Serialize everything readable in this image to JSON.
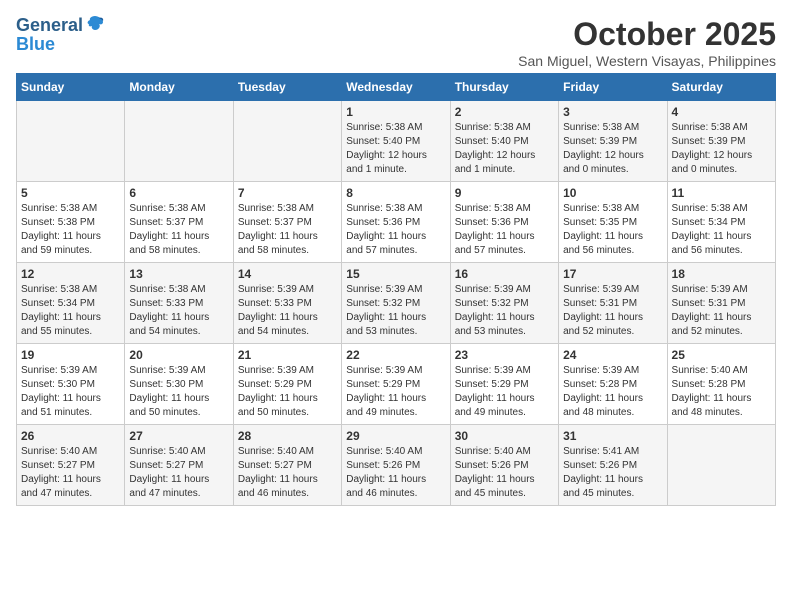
{
  "logo": {
    "line1": "General",
    "line2": "Blue"
  },
  "title": "October 2025",
  "location": "San Miguel, Western Visayas, Philippines",
  "weekdays": [
    "Sunday",
    "Monday",
    "Tuesday",
    "Wednesday",
    "Thursday",
    "Friday",
    "Saturday"
  ],
  "weeks": [
    [
      {
        "day": "",
        "info": ""
      },
      {
        "day": "",
        "info": ""
      },
      {
        "day": "",
        "info": ""
      },
      {
        "day": "1",
        "info": "Sunrise: 5:38 AM\nSunset: 5:40 PM\nDaylight: 12 hours\nand 1 minute."
      },
      {
        "day": "2",
        "info": "Sunrise: 5:38 AM\nSunset: 5:40 PM\nDaylight: 12 hours\nand 1 minute."
      },
      {
        "day": "3",
        "info": "Sunrise: 5:38 AM\nSunset: 5:39 PM\nDaylight: 12 hours\nand 0 minutes."
      },
      {
        "day": "4",
        "info": "Sunrise: 5:38 AM\nSunset: 5:39 PM\nDaylight: 12 hours\nand 0 minutes."
      }
    ],
    [
      {
        "day": "5",
        "info": "Sunrise: 5:38 AM\nSunset: 5:38 PM\nDaylight: 11 hours\nand 59 minutes."
      },
      {
        "day": "6",
        "info": "Sunrise: 5:38 AM\nSunset: 5:37 PM\nDaylight: 11 hours\nand 58 minutes."
      },
      {
        "day": "7",
        "info": "Sunrise: 5:38 AM\nSunset: 5:37 PM\nDaylight: 11 hours\nand 58 minutes."
      },
      {
        "day": "8",
        "info": "Sunrise: 5:38 AM\nSunset: 5:36 PM\nDaylight: 11 hours\nand 57 minutes."
      },
      {
        "day": "9",
        "info": "Sunrise: 5:38 AM\nSunset: 5:36 PM\nDaylight: 11 hours\nand 57 minutes."
      },
      {
        "day": "10",
        "info": "Sunrise: 5:38 AM\nSunset: 5:35 PM\nDaylight: 11 hours\nand 56 minutes."
      },
      {
        "day": "11",
        "info": "Sunrise: 5:38 AM\nSunset: 5:34 PM\nDaylight: 11 hours\nand 56 minutes."
      }
    ],
    [
      {
        "day": "12",
        "info": "Sunrise: 5:38 AM\nSunset: 5:34 PM\nDaylight: 11 hours\nand 55 minutes."
      },
      {
        "day": "13",
        "info": "Sunrise: 5:38 AM\nSunset: 5:33 PM\nDaylight: 11 hours\nand 54 minutes."
      },
      {
        "day": "14",
        "info": "Sunrise: 5:39 AM\nSunset: 5:33 PM\nDaylight: 11 hours\nand 54 minutes."
      },
      {
        "day": "15",
        "info": "Sunrise: 5:39 AM\nSunset: 5:32 PM\nDaylight: 11 hours\nand 53 minutes."
      },
      {
        "day": "16",
        "info": "Sunrise: 5:39 AM\nSunset: 5:32 PM\nDaylight: 11 hours\nand 53 minutes."
      },
      {
        "day": "17",
        "info": "Sunrise: 5:39 AM\nSunset: 5:31 PM\nDaylight: 11 hours\nand 52 minutes."
      },
      {
        "day": "18",
        "info": "Sunrise: 5:39 AM\nSunset: 5:31 PM\nDaylight: 11 hours\nand 52 minutes."
      }
    ],
    [
      {
        "day": "19",
        "info": "Sunrise: 5:39 AM\nSunset: 5:30 PM\nDaylight: 11 hours\nand 51 minutes."
      },
      {
        "day": "20",
        "info": "Sunrise: 5:39 AM\nSunset: 5:30 PM\nDaylight: 11 hours\nand 50 minutes."
      },
      {
        "day": "21",
        "info": "Sunrise: 5:39 AM\nSunset: 5:29 PM\nDaylight: 11 hours\nand 50 minutes."
      },
      {
        "day": "22",
        "info": "Sunrise: 5:39 AM\nSunset: 5:29 PM\nDaylight: 11 hours\nand 49 minutes."
      },
      {
        "day": "23",
        "info": "Sunrise: 5:39 AM\nSunset: 5:29 PM\nDaylight: 11 hours\nand 49 minutes."
      },
      {
        "day": "24",
        "info": "Sunrise: 5:39 AM\nSunset: 5:28 PM\nDaylight: 11 hours\nand 48 minutes."
      },
      {
        "day": "25",
        "info": "Sunrise: 5:40 AM\nSunset: 5:28 PM\nDaylight: 11 hours\nand 48 minutes."
      }
    ],
    [
      {
        "day": "26",
        "info": "Sunrise: 5:40 AM\nSunset: 5:27 PM\nDaylight: 11 hours\nand 47 minutes."
      },
      {
        "day": "27",
        "info": "Sunrise: 5:40 AM\nSunset: 5:27 PM\nDaylight: 11 hours\nand 47 minutes."
      },
      {
        "day": "28",
        "info": "Sunrise: 5:40 AM\nSunset: 5:27 PM\nDaylight: 11 hours\nand 46 minutes."
      },
      {
        "day": "29",
        "info": "Sunrise: 5:40 AM\nSunset: 5:26 PM\nDaylight: 11 hours\nand 46 minutes."
      },
      {
        "day": "30",
        "info": "Sunrise: 5:40 AM\nSunset: 5:26 PM\nDaylight: 11 hours\nand 45 minutes."
      },
      {
        "day": "31",
        "info": "Sunrise: 5:41 AM\nSunset: 5:26 PM\nDaylight: 11 hours\nand 45 minutes."
      },
      {
        "day": "",
        "info": ""
      }
    ]
  ]
}
